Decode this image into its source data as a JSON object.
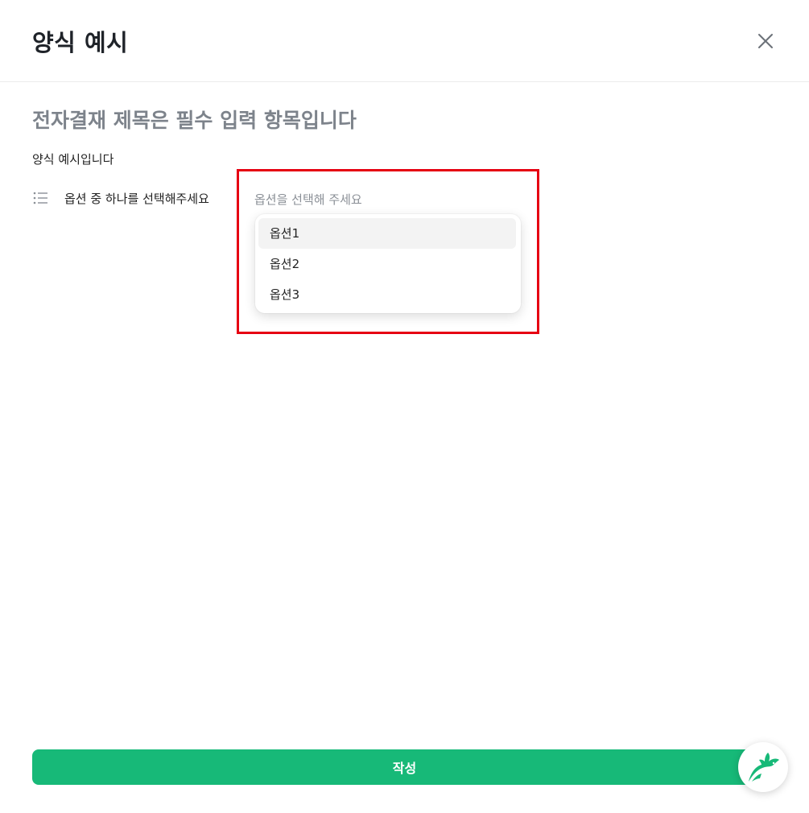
{
  "header": {
    "title": "양식 예시",
    "close_icon": "close-icon"
  },
  "form": {
    "heading": "전자결재 제목은 필수 입력 항목입니다",
    "description": "양식 예시입니다",
    "field": {
      "icon": "list-icon",
      "label": "옵션 중 하나를 선택해주세요",
      "placeholder": "옵션을 선택해 주세요",
      "options": [
        "옵션1",
        "옵션2",
        "옵션3"
      ],
      "hovered_option": "옵션1"
    }
  },
  "footer": {
    "submit_label": "작성"
  },
  "chat": {
    "icon": "rabbit-logo-icon"
  },
  "colors": {
    "accent": "#17b978",
    "highlight": "#e60012",
    "heading_gray": "#7d838b",
    "placeholder_gray": "#8a8f96"
  }
}
